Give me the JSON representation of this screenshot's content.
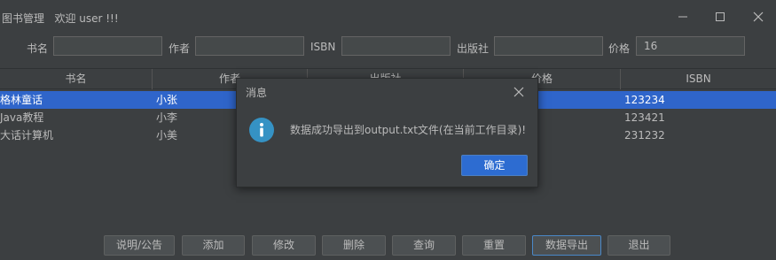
{
  "window": {
    "title": "图书管理   欢迎 user !!!",
    "minimize_icon": "minimize-icon",
    "maximize_icon": "maximize-icon",
    "close_icon": "close-icon"
  },
  "search": {
    "bookname_label": "书名",
    "bookname_value": "",
    "author_label": "作者",
    "author_value": "",
    "isbn_label": "ISBN",
    "isbn_value": "",
    "publisher_label": "出版社",
    "publisher_value": "",
    "price_label": "价格",
    "price_value": "16"
  },
  "table": {
    "columns": [
      "书名",
      "作者",
      "出版社",
      "价格",
      "ISBN"
    ],
    "rows": [
      {
        "name": "格林童话",
        "author": "小张",
        "isbn": "123234",
        "selected": true
      },
      {
        "name": "Java教程",
        "author": "小李",
        "isbn": "123421",
        "selected": false
      },
      {
        "name": "大话计算机",
        "author": "小美",
        "isbn": "231232",
        "selected": false
      }
    ]
  },
  "buttons": {
    "about": "说明/公告",
    "add": "添加",
    "edit": "修改",
    "delete": "删除",
    "query": "查询",
    "reset": "重置",
    "export": "数据导出",
    "exit": "退出"
  },
  "dialog": {
    "title": "消息",
    "message": "数据成功导出到output.txt文件(在当前工作目录)!",
    "ok": "确定",
    "icon": "info-icon"
  },
  "colors": {
    "background": "#3c3f41",
    "selection": "#2f65ca",
    "primary_button": "#2d6cd1",
    "info_icon": "#3592c4"
  }
}
